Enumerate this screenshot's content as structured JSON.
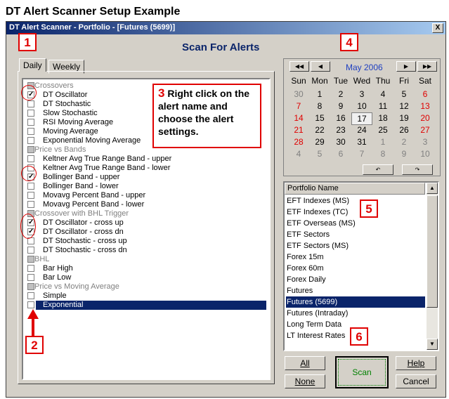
{
  "page_title": "DT Alert Scanner Setup Example",
  "window": {
    "title": "DT Alert Scanner - Portfolio - [Futures (5699)]",
    "close_label": "X"
  },
  "heading": "Scan For Alerts",
  "tabs": [
    {
      "label": "Daily"
    },
    {
      "label": "Weekly"
    }
  ],
  "alert_list": [
    {
      "kind": "group",
      "label": "Crossovers"
    },
    {
      "kind": "item",
      "label": "DT Oscillator",
      "checked": true
    },
    {
      "kind": "item",
      "label": "DT Stochastic",
      "checked": false
    },
    {
      "kind": "item",
      "label": "Slow Stochastic",
      "checked": false
    },
    {
      "kind": "item",
      "label": "RSI Moving Average",
      "checked": false
    },
    {
      "kind": "item",
      "label": "Moving Average",
      "checked": false
    },
    {
      "kind": "item",
      "label": "Exponential Moving Average",
      "checked": false
    },
    {
      "kind": "group",
      "label": "Price vs Bands"
    },
    {
      "kind": "item",
      "label": "Keltner Avg True Range Band - upper",
      "checked": false
    },
    {
      "kind": "item",
      "label": "Keltner Avg True Range Band - lower",
      "checked": false
    },
    {
      "kind": "item",
      "label": "Bollinger Band - upper",
      "checked": true
    },
    {
      "kind": "item",
      "label": "Bollinger Band - lower",
      "checked": false
    },
    {
      "kind": "item",
      "label": "Movavg Percent Band - upper",
      "checked": false
    },
    {
      "kind": "item",
      "label": "Movavg Percent Band - lower",
      "checked": false
    },
    {
      "kind": "group",
      "label": "Crossover with BHL Trigger"
    },
    {
      "kind": "item",
      "label": "DT Oscillator - cross up",
      "checked": true
    },
    {
      "kind": "item",
      "label": "DT Oscillator - cross dn",
      "checked": true
    },
    {
      "kind": "item",
      "label": "DT Stochastic - cross up",
      "checked": false
    },
    {
      "kind": "item",
      "label": "DT Stochastic - cross dn",
      "checked": false
    },
    {
      "kind": "group",
      "label": "BHL"
    },
    {
      "kind": "item",
      "label": "Bar High",
      "checked": false
    },
    {
      "kind": "item",
      "label": "Bar Low",
      "checked": false
    },
    {
      "kind": "group",
      "label": "Price vs Moving Average"
    },
    {
      "kind": "item",
      "label": "Simple",
      "checked": false
    },
    {
      "kind": "item",
      "label": "Exponential",
      "checked": false,
      "selected": true
    }
  ],
  "callouts": {
    "n1": "1",
    "n2": "2",
    "n3": "3",
    "n4": "4",
    "n5": "5",
    "n6": "6"
  },
  "note_text": "Right click on the alert name and choose the alert settings.",
  "calendar": {
    "month": "May 2006",
    "weekdays": [
      "Sun",
      "Mon",
      "Tue",
      "Wed",
      "Thu",
      "Fri",
      "Sat"
    ],
    "weeks": [
      [
        "30",
        "1",
        "2",
        "3",
        "4",
        "5",
        "6"
      ],
      [
        "7",
        "8",
        "9",
        "10",
        "11",
        "12",
        "13"
      ],
      [
        "14",
        "15",
        "16",
        "17",
        "18",
        "19",
        "20"
      ],
      [
        "21",
        "22",
        "23",
        "24",
        "25",
        "26",
        "27"
      ],
      [
        "28",
        "29",
        "30",
        "31",
        "1",
        "2",
        "3"
      ],
      [
        "4",
        "5",
        "6",
        "7",
        "8",
        "9",
        "10"
      ]
    ],
    "today": "17",
    "nav": {
      "first": "◀◀",
      "prev": "◀",
      "next": "▶",
      "last": "▶▶"
    },
    "undo_icon": "↶",
    "redo_icon": "↷"
  },
  "portfolio": {
    "header": "Portfolio Name",
    "items": [
      "EFT Indexes (MS)",
      "ETF Indexes (TC)",
      "ETF Overseas (MS)",
      "ETF Sectors",
      "ETF Sectors (MS)",
      "Forex 15m",
      "Forex 60m",
      "Forex Daily",
      "Futures",
      "Futures (5699)",
      "Futures (Intraday)",
      "Long Term Data",
      "LT Interest Rates"
    ],
    "selected": "Futures (5699)"
  },
  "buttons": {
    "all": "All",
    "none": "None",
    "scan": "Scan",
    "help": "Help",
    "cancel": "Cancel"
  },
  "colors": {
    "accent_red": "#e00000",
    "selection": "#0a246a",
    "heading": "#0a246a",
    "scan_green": "#008000"
  }
}
